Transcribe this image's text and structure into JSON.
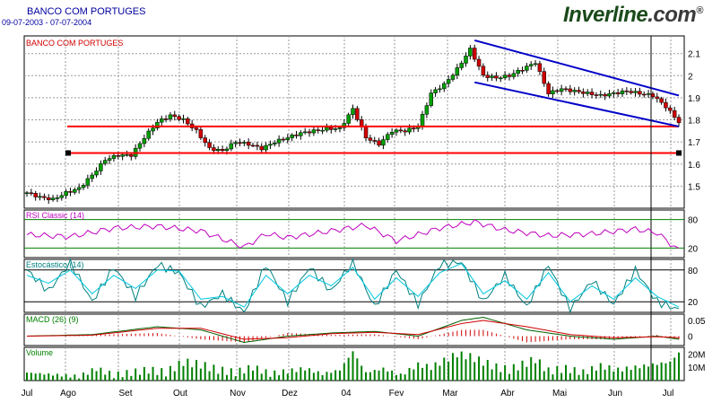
{
  "header": {
    "title": "BANCO COM PORTUGES",
    "date_range": "09-07-2003 - 07-07-2004",
    "brand_main": "Inverline",
    "brand_suffix": ".com",
    "brand_mark": "®"
  },
  "colors": {
    "up_candle": "#00a000",
    "down_candle": "#d00000",
    "support_line": "#ff0000",
    "channel_line": "#0000c8",
    "rsi": "#c000c0",
    "stoch_k": "#008080",
    "stoch_d": "#00c8e0",
    "macd": "#006000",
    "macd_signal": "#d00000",
    "volume": "#008000",
    "grid": "#9a9a9a"
  },
  "chart_data": [
    {
      "type": "candlestick",
      "legend": "BANCO COM PORTUGES",
      "ylim": [
        1.4,
        2.18
      ],
      "yticks": [
        "1.5",
        "1.6",
        "1.7",
        "1.8",
        "1.9",
        "2",
        "2.1"
      ],
      "x_labels": [
        "Jul",
        "Ago",
        "Set",
        "Out",
        "Nov",
        "Dez",
        "04",
        "Fev",
        "Mar",
        "Abr",
        "Mai",
        "Jun",
        "Jul"
      ],
      "price_series": {
        "name": "close",
        "points": [
          [
            0,
            1.47
          ],
          [
            3,
            1.45
          ],
          [
            6,
            1.44
          ],
          [
            9,
            1.47
          ],
          [
            12,
            1.49
          ],
          [
            15,
            1.55
          ],
          [
            18,
            1.62
          ],
          [
            21,
            1.64
          ],
          [
            24,
            1.64
          ],
          [
            27,
            1.72
          ],
          [
            30,
            1.79
          ],
          [
            33,
            1.82
          ],
          [
            36,
            1.8
          ],
          [
            39,
            1.75
          ],
          [
            42,
            1.67
          ],
          [
            45,
            1.66
          ],
          [
            48,
            1.7
          ],
          [
            51,
            1.69
          ],
          [
            54,
            1.67
          ],
          [
            57,
            1.7
          ],
          [
            60,
            1.72
          ],
          [
            63,
            1.74
          ],
          [
            66,
            1.75
          ],
          [
            69,
            1.76
          ],
          [
            72,
            1.76
          ],
          [
            75,
            1.85
          ],
          [
            78,
            1.72
          ],
          [
            81,
            1.69
          ],
          [
            84,
            1.75
          ],
          [
            87,
            1.75
          ],
          [
            90,
            1.77
          ],
          [
            93,
            1.92
          ],
          [
            96,
            1.96
          ],
          [
            99,
            2.03
          ],
          [
            102,
            2.12
          ],
          [
            105,
            2.0
          ],
          [
            108,
            1.99
          ],
          [
            111,
            2.0
          ],
          [
            114,
            2.03
          ],
          [
            117,
            2.06
          ],
          [
            120,
            1.92
          ],
          [
            123,
            1.94
          ],
          [
            126,
            1.93
          ],
          [
            129,
            1.92
          ],
          [
            132,
            1.91
          ],
          [
            135,
            1.92
          ],
          [
            138,
            1.93
          ],
          [
            141,
            1.92
          ],
          [
            144,
            1.91
          ],
          [
            147,
            1.86
          ],
          [
            150,
            1.79
          ]
        ]
      },
      "support_lines": [
        1.77,
        1.65
      ],
      "channel": {
        "upper": [
          [
            103,
            2.16
          ],
          [
            150,
            1.91
          ]
        ],
        "lower": [
          [
            103,
            1.97
          ],
          [
            150,
            1.77
          ]
        ]
      }
    },
    {
      "type": "line",
      "legend": "RSI Classic (14)",
      "ylim": [
        0,
        100
      ],
      "yticks": [
        "80",
        "20"
      ],
      "series": [
        {
          "name": "RSI",
          "points": [
            [
              0,
              48
            ],
            [
              10,
              44
            ],
            [
              20,
              62
            ],
            [
              30,
              66
            ],
            [
              40,
              56
            ],
            [
              50,
              22
            ],
            [
              55,
              50
            ],
            [
              60,
              42
            ],
            [
              70,
              56
            ],
            [
              78,
              68
            ],
            [
              85,
              35
            ],
            [
              95,
              62
            ],
            [
              103,
              75
            ],
            [
              110,
              58
            ],
            [
              120,
              46
            ],
            [
              130,
              50
            ],
            [
              140,
              60
            ],
            [
              145,
              52
            ],
            [
              150,
              15
            ]
          ]
        }
      ]
    },
    {
      "type": "line",
      "legend": "Estocástico (14)",
      "ylim": [
        0,
        100
      ],
      "yticks": [
        "80",
        "20"
      ],
      "series": [
        {
          "name": "%K",
          "points": [
            [
              0,
              80
            ],
            [
              5,
              40
            ],
            [
              10,
              95
            ],
            [
              15,
              20
            ],
            [
              20,
              85
            ],
            [
              25,
              30
            ],
            [
              30,
              90
            ],
            [
              35,
              75
            ],
            [
              40,
              10
            ],
            [
              45,
              35
            ],
            [
              50,
              0
            ],
            [
              55,
              90
            ],
            [
              60,
              20
            ],
            [
              65,
              85
            ],
            [
              70,
              40
            ],
            [
              75,
              95
            ],
            [
              80,
              10
            ],
            [
              85,
              80
            ],
            [
              90,
              15
            ],
            [
              95,
              90
            ],
            [
              100,
              95
            ],
            [
              105,
              20
            ],
            [
              110,
              70
            ],
            [
              115,
              10
            ],
            [
              120,
              90
            ],
            [
              125,
              5
            ],
            [
              130,
              60
            ],
            [
              135,
              15
            ],
            [
              140,
              80
            ],
            [
              145,
              20
            ],
            [
              150,
              5
            ]
          ]
        },
        {
          "name": "%D",
          "points": [
            [
              0,
              70
            ],
            [
              5,
              55
            ],
            [
              10,
              80
            ],
            [
              15,
              35
            ],
            [
              20,
              70
            ],
            [
              25,
              45
            ],
            [
              30,
              80
            ],
            [
              35,
              78
            ],
            [
              40,
              25
            ],
            [
              45,
              30
            ],
            [
              50,
              10
            ],
            [
              55,
              70
            ],
            [
              60,
              35
            ],
            [
              65,
              70
            ],
            [
              70,
              50
            ],
            [
              75,
              85
            ],
            [
              80,
              25
            ],
            [
              85,
              65
            ],
            [
              90,
              30
            ],
            [
              95,
              75
            ],
            [
              100,
              92
            ],
            [
              105,
              35
            ],
            [
              110,
              60
            ],
            [
              115,
              25
            ],
            [
              120,
              75
            ],
            [
              125,
              20
            ],
            [
              130,
              50
            ],
            [
              135,
              25
            ],
            [
              140,
              65
            ],
            [
              145,
              30
            ],
            [
              150,
              10
            ]
          ]
        }
      ]
    },
    {
      "type": "line",
      "legend": "MACD (26) (9)",
      "ylim": [
        -0.03,
        0.07
      ],
      "yticks": [
        "0.05",
        "0"
      ],
      "series": [
        {
          "name": "MACD",
          "points": [
            [
              0,
              0.0
            ],
            [
              15,
              0.005
            ],
            [
              30,
              0.03
            ],
            [
              40,
              0.02
            ],
            [
              50,
              -0.02
            ],
            [
              60,
              0.0
            ],
            [
              70,
              0.01
            ],
            [
              80,
              0.015
            ],
            [
              90,
              0.0
            ],
            [
              100,
              0.05
            ],
            [
              105,
              0.06
            ],
            [
              115,
              0.02
            ],
            [
              125,
              0.0
            ],
            [
              135,
              -0.01
            ],
            [
              145,
              0.0
            ],
            [
              150,
              -0.01
            ]
          ]
        },
        {
          "name": "Signal",
          "points": [
            [
              0,
              0.0
            ],
            [
              15,
              0.003
            ],
            [
              30,
              0.025
            ],
            [
              40,
              0.025
            ],
            [
              50,
              -0.01
            ],
            [
              60,
              -0.005
            ],
            [
              70,
              0.008
            ],
            [
              80,
              0.012
            ],
            [
              90,
              0.005
            ],
            [
              100,
              0.04
            ],
            [
              105,
              0.05
            ],
            [
              115,
              0.03
            ],
            [
              125,
              0.005
            ],
            [
              135,
              -0.005
            ],
            [
              145,
              -0.002
            ],
            [
              150,
              -0.005
            ]
          ]
        }
      ]
    },
    {
      "type": "bar",
      "legend": "Volume",
      "ylim": [
        0,
        25000000
      ],
      "yticks": [
        "20M",
        "10M"
      ],
      "series": [
        {
          "name": "Volume",
          "points": [
            [
              0,
              6
            ],
            [
              4,
              5
            ],
            [
              8,
              4
            ],
            [
              12,
              3
            ],
            [
              16,
              9
            ],
            [
              20,
              4
            ],
            [
              24,
              6
            ],
            [
              28,
              8
            ],
            [
              32,
              6
            ],
            [
              36,
              14
            ],
            [
              40,
              12
            ],
            [
              44,
              8
            ],
            [
              48,
              6
            ],
            [
              52,
              10
            ],
            [
              56,
              5
            ],
            [
              60,
              7
            ],
            [
              64,
              9
            ],
            [
              68,
              5
            ],
            [
              72,
              8
            ],
            [
              75,
              22
            ],
            [
              78,
              6
            ],
            [
              82,
              9
            ],
            [
              86,
              4
            ],
            [
              90,
              12
            ],
            [
              93,
              10
            ],
            [
              96,
              15
            ],
            [
              99,
              20
            ],
            [
              102,
              18
            ],
            [
              105,
              14
            ],
            [
              108,
              10
            ],
            [
              111,
              8
            ],
            [
              114,
              12
            ],
            [
              117,
              16
            ],
            [
              120,
              7
            ],
            [
              124,
              9
            ],
            [
              128,
              6
            ],
            [
              132,
              11
            ],
            [
              136,
              8
            ],
            [
              140,
              10
            ],
            [
              144,
              12
            ],
            [
              148,
              14
            ],
            [
              150,
              21
            ]
          ]
        }
      ]
    }
  ]
}
